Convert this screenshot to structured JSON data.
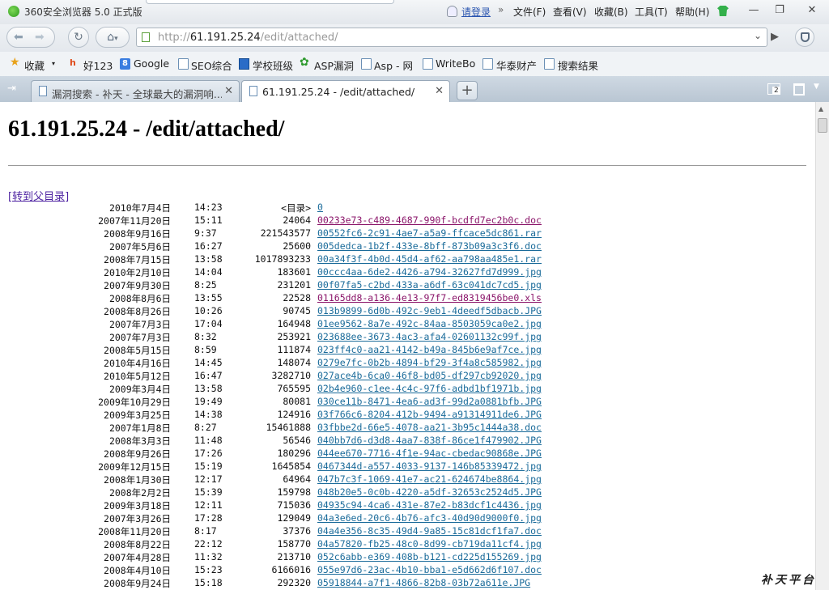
{
  "window": {
    "title": "360安全浏览器 5.0 正式版",
    "login_link": "请登录",
    "menu_chevron": "»",
    "menus": [
      "文件(F)",
      "查看(V)",
      "收藏(B)",
      "工具(T)",
      "帮助(H)"
    ],
    "minimize": "—",
    "maximize": "❐",
    "close": "✕"
  },
  "address_bar": {
    "scheme": "http://",
    "host": "61.191.25.24",
    "path": "/edit/attached/",
    "dropdown_icon": "chevron-down",
    "go_icon": "play"
  },
  "favorites": [
    "收藏",
    "好123",
    "Google",
    "SEO综合",
    "学校班级",
    "ASP漏洞",
    "Asp - 网",
    "WriteBo",
    "华泰财产",
    "搜索结果"
  ],
  "tabs": [
    {
      "label": "漏洞搜索 - 补天 - 全球最大的漏洞响...",
      "active": false
    },
    {
      "label": "61.191.25.24 - /edit/attached/",
      "active": true
    }
  ],
  "tab_close": "✕",
  "new_tab": "+",
  "closed_tabs_count": "2",
  "page": {
    "heading": "61.191.25.24 - /edit/attached/",
    "parent_link": "[转到父目录]",
    "rows": [
      {
        "date": "2010年7月4日",
        "time": "14:23",
        "size": "<目录>",
        "name": "0",
        "state": "link"
      },
      {
        "date": "2007年11月20日",
        "time": "15:11",
        "size": "24064",
        "name": "00233e73-c489-4687-990f-bcdfd7ec2b0c.doc",
        "state": "visited"
      },
      {
        "date": "2008年9月16日",
        "time": "9:37",
        "size": "221543577",
        "name": "00552fc6-2c91-4ae7-a5a9-ffcace5dc861.rar",
        "state": "link"
      },
      {
        "date": "2007年5月6日",
        "time": "16:27",
        "size": "25600",
        "name": "005dedca-1b2f-433e-8bff-873b09a3c3f6.doc",
        "state": "link"
      },
      {
        "date": "2008年7月15日",
        "time": "13:58",
        "size": "1017893233",
        "name": "00a34f3f-4b0d-45d4-af62-aa798aa485e1.rar",
        "state": "link"
      },
      {
        "date": "2010年2月10日",
        "time": "14:04",
        "size": "183601",
        "name": "00ccc4aa-6de2-4426-a794-32627fd7d999.jpg",
        "state": "link"
      },
      {
        "date": "2007年9月30日",
        "time": "8:25",
        "size": "231201",
        "name": "00f07fa5-c2bd-433a-a6df-63c041dc7cd5.jpg",
        "state": "link"
      },
      {
        "date": "2008年8月6日",
        "time": "13:55",
        "size": "22528",
        "name": "01165dd8-a136-4e13-97f7-ed8319456be0.xls",
        "state": "visited"
      },
      {
        "date": "2008年8月26日",
        "time": "10:26",
        "size": "90745",
        "name": "013b9899-6d0b-492c-9eb1-4deedf5dbacb.JPG",
        "state": "link"
      },
      {
        "date": "2007年7月3日",
        "time": "17:04",
        "size": "164948",
        "name": "01ee9562-8a7e-492c-84aa-8503059ca0e2.jpg",
        "state": "link"
      },
      {
        "date": "2007年7月3日",
        "time": "8:32",
        "size": "253921",
        "name": "023688ee-3673-4ac3-afa4-02601132c99f.jpg",
        "state": "link"
      },
      {
        "date": "2008年5月15日",
        "time": "8:59",
        "size": "111874",
        "name": "023ff4c0-aa21-4142-b49a-845b6e9af7ce.jpg",
        "state": "link"
      },
      {
        "date": "2010年4月16日",
        "time": "14:45",
        "size": "148074",
        "name": "0279e7fc-0b2b-4894-bf29-3f4a8c585982.jpg",
        "state": "link"
      },
      {
        "date": "2010年5月12日",
        "time": "16:47",
        "size": "3282710",
        "name": "027ace4b-6ca0-46f8-bd05-df297cb92020.jpg",
        "state": "link"
      },
      {
        "date": "2009年3月4日",
        "time": "13:58",
        "size": "765595",
        "name": "02b4e960-c1ee-4c4c-97f6-adbd1bf1971b.jpg",
        "state": "link"
      },
      {
        "date": "2009年10月29日",
        "time": "19:49",
        "size": "80081",
        "name": "030ce11b-8471-4ea6-ad3f-99d2a0881bfb.JPG",
        "state": "link"
      },
      {
        "date": "2009年3月25日",
        "time": "14:38",
        "size": "124916",
        "name": "03f766c6-8204-412b-9494-a91314911de6.JPG",
        "state": "link"
      },
      {
        "date": "2007年1月8日",
        "time": "8:27",
        "size": "15461888",
        "name": "03fbbe2d-66e5-4078-aa21-3b95c1444a38.doc",
        "state": "link"
      },
      {
        "date": "2008年3月3日",
        "time": "11:48",
        "size": "56546",
        "name": "040bb7d6-d3d8-4aa7-838f-86ce1f479902.JPG",
        "state": "link"
      },
      {
        "date": "2008年9月26日",
        "time": "17:26",
        "size": "180296",
        "name": "044ee670-7716-4f1e-94ac-cbedac90868e.JPG",
        "state": "link"
      },
      {
        "date": "2009年12月15日",
        "time": "15:19",
        "size": "1645854",
        "name": "0467344d-a557-4033-9137-146b85339472.jpg",
        "state": "link"
      },
      {
        "date": "2008年1月30日",
        "time": "12:17",
        "size": "64964",
        "name": "047b7c3f-1069-41e7-ac21-624674be8864.jpg",
        "state": "link"
      },
      {
        "date": "2008年2月2日",
        "time": "15:39",
        "size": "159798",
        "name": "048b20e5-0c0b-4220-a5df-32653c2524d5.JPG",
        "state": "link"
      },
      {
        "date": "2009年3月18日",
        "time": "12:11",
        "size": "715036",
        "name": "04935c94-4ca6-431e-87e2-b83dcf1c4436.jpg",
        "state": "link"
      },
      {
        "date": "2007年3月26日",
        "time": "17:28",
        "size": "129049",
        "name": "04a3e6ed-20c6-4b76-afc3-40d90d9000f0.jpg",
        "state": "link"
      },
      {
        "date": "2008年11月20日",
        "time": "8:17",
        "size": "37376",
        "name": "04a4e356-8c35-49d4-9a85-15c81dcf1fa7.doc",
        "state": "link"
      },
      {
        "date": "2008年8月22日",
        "time": "22:12",
        "size": "158770",
        "name": "04a57820-fb25-48c0-8d99-cb719da11cf4.jpg",
        "state": "link"
      },
      {
        "date": "2007年4月28日",
        "time": "11:32",
        "size": "213710",
        "name": "052c6abb-e369-408b-b121-cd225d155269.jpg",
        "state": "link"
      },
      {
        "date": "2008年4月10日",
        "time": "15:23",
        "size": "6166016",
        "name": "055e97d6-23ac-4b10-bba1-e5d662d6f107.doc",
        "state": "link"
      },
      {
        "date": "2008年9月24日",
        "time": "15:18",
        "size": "292320",
        "name": "05918844-a7f1-4866-82b8-03b72a611e.JPG",
        "state": "link"
      }
    ]
  },
  "watermark": "补天平台"
}
